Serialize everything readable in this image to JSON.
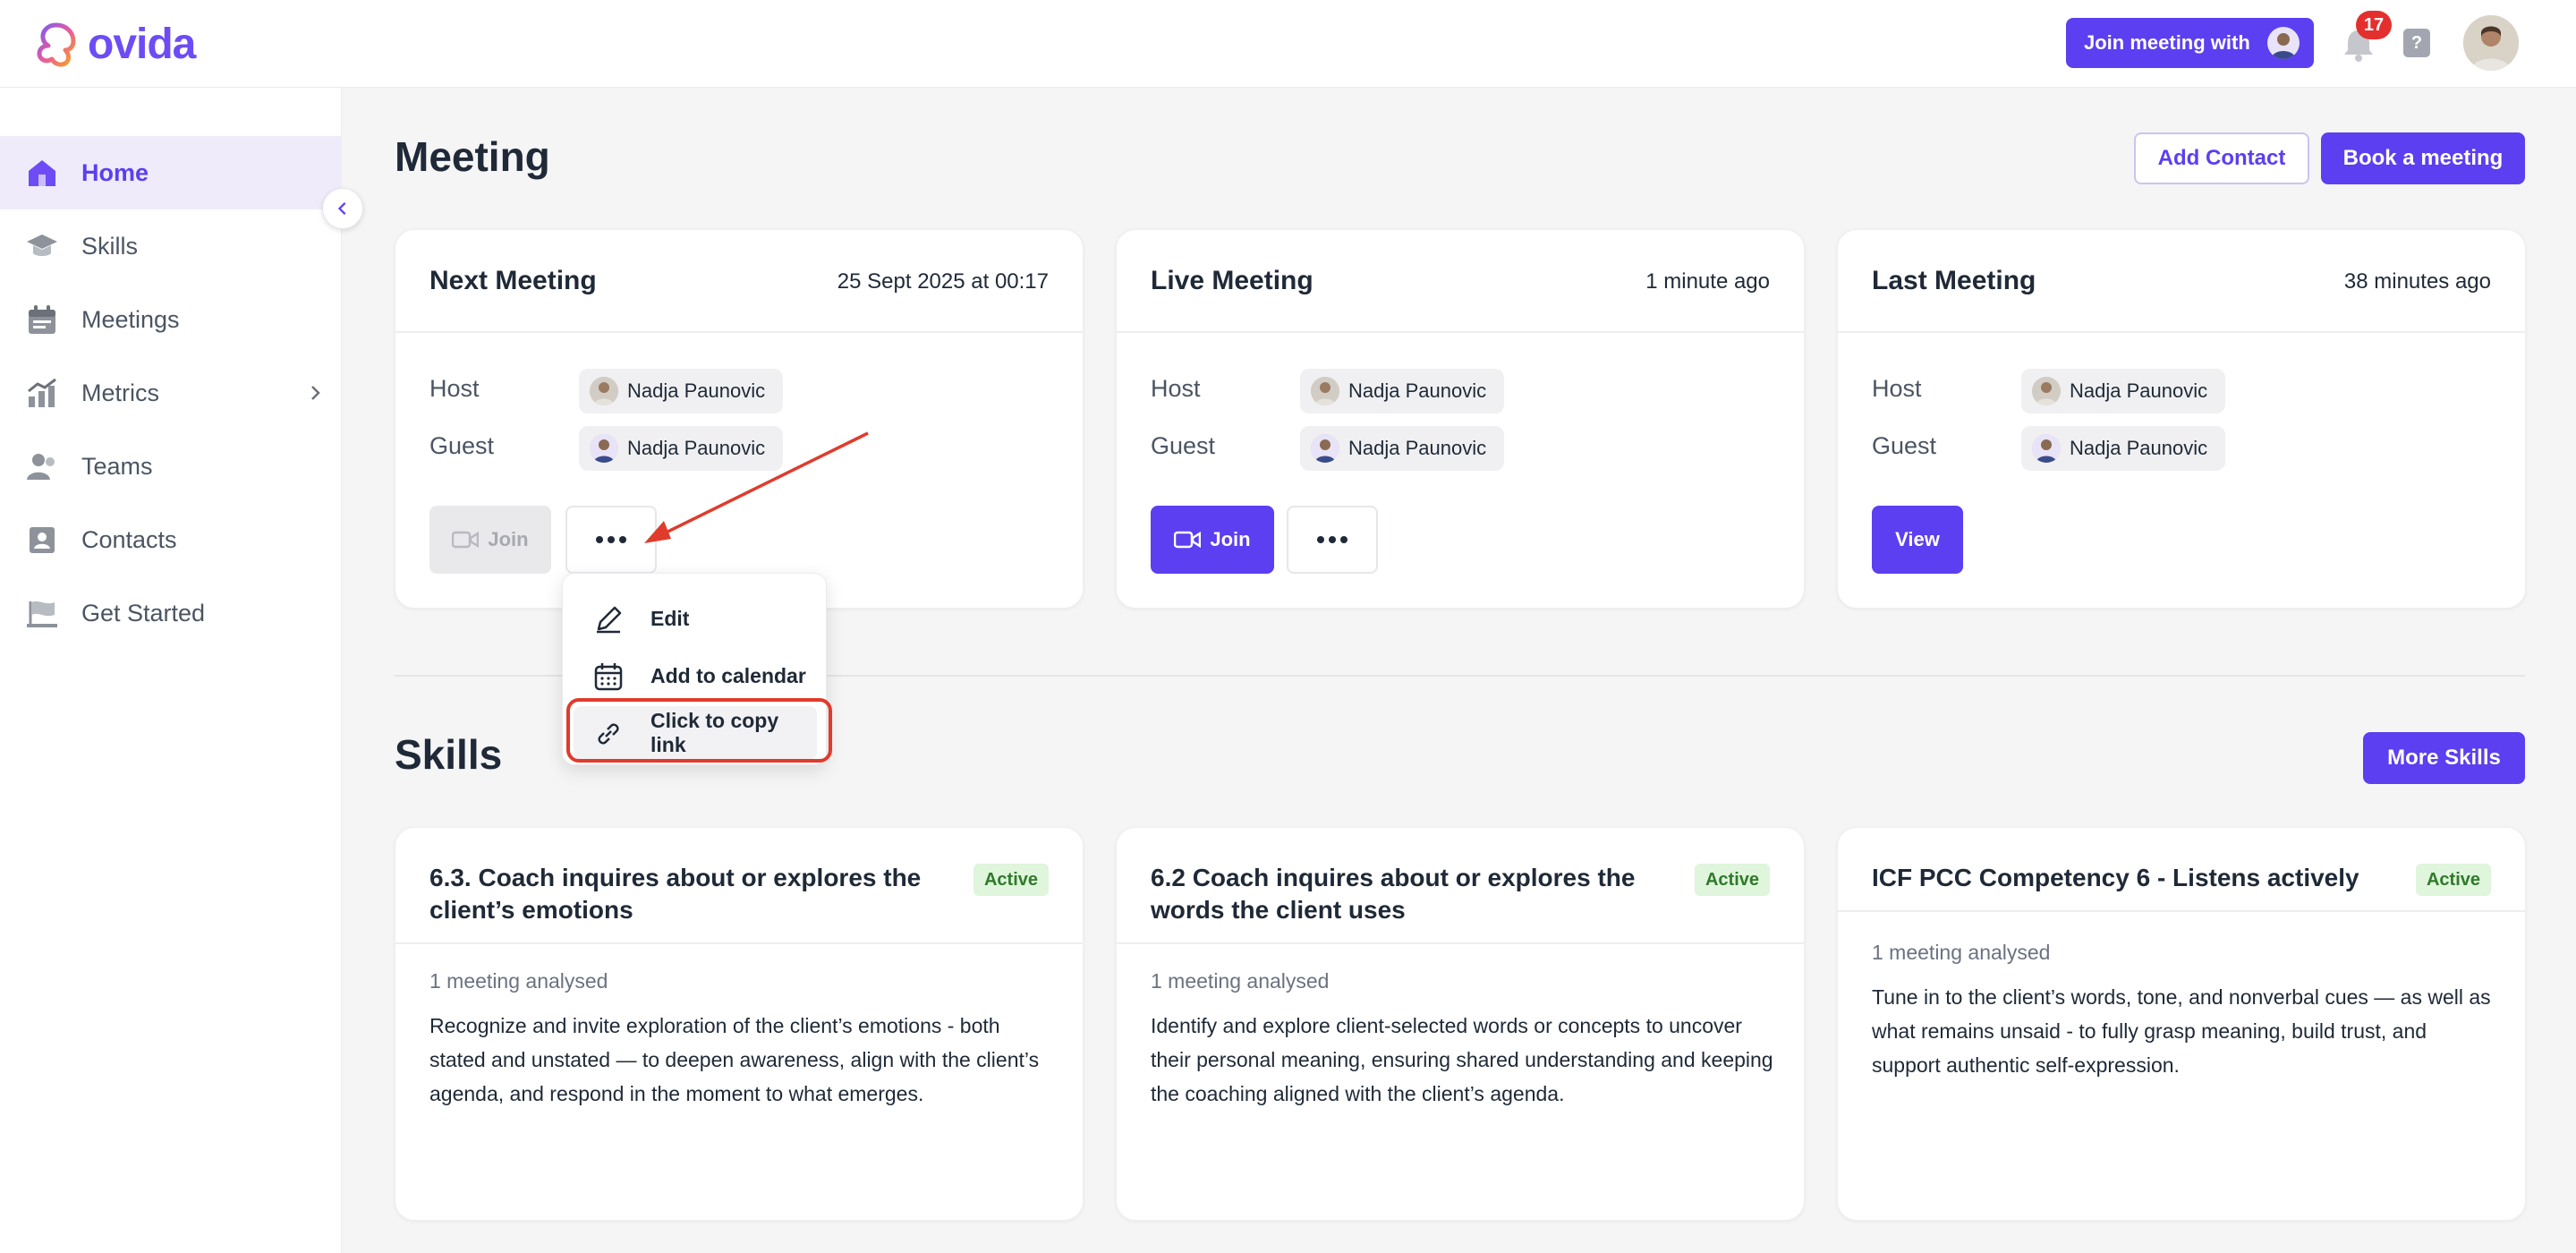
{
  "app": {
    "name": "ovida",
    "accent": "#5b3ff0"
  },
  "topbar": {
    "join_with_label": "Join meeting with",
    "notification_count": "17",
    "help_label": "?"
  },
  "sidebar": {
    "items": [
      {
        "label": "Home",
        "icon": "home-icon",
        "active": true
      },
      {
        "label": "Skills",
        "icon": "graduation-cap-icon"
      },
      {
        "label": "Meetings",
        "icon": "calendar-icon"
      },
      {
        "label": "Metrics",
        "icon": "chart-icon",
        "has_submenu": true
      },
      {
        "label": "Teams",
        "icon": "people-icon"
      },
      {
        "label": "Contacts",
        "icon": "contact-card-icon"
      },
      {
        "label": "Get Started",
        "icon": "flag-icon"
      }
    ]
  },
  "main": {
    "title": "Meeting",
    "add_contact_label": "Add Contact",
    "book_meeting_label": "Book a meeting",
    "meetings": [
      {
        "title": "Next Meeting",
        "time": "25 Sept 2025 at 00:17",
        "host_label": "Host",
        "host_name": "Nadja Paunovic",
        "guest_label": "Guest",
        "guest_name": "Nadja Paunovic",
        "join_label": "Join"
      },
      {
        "title": "Live Meeting",
        "time": "1 minute ago",
        "host_label": "Host",
        "host_name": "Nadja Paunovic",
        "guest_label": "Guest",
        "guest_name": "Nadja Paunovic",
        "join_label": "Join"
      },
      {
        "title": "Last Meeting",
        "time": "38 minutes ago",
        "host_label": "Host",
        "host_name": "Nadja Paunovic",
        "guest_label": "Guest",
        "guest_name": "Nadja Paunovic",
        "view_label": "View"
      }
    ],
    "menu": {
      "items": [
        {
          "label": "Edit",
          "icon": "pencil-icon"
        },
        {
          "label": "Add to calendar",
          "icon": "calendar-icon"
        },
        {
          "label": "Click to copy link",
          "icon": "link-icon"
        }
      ]
    },
    "skills_title": "Skills",
    "more_skills_label": "More Skills",
    "skills": [
      {
        "title": "6.3. Coach inquires about or explores the client’s emotions",
        "status": "Active",
        "meta": "1 meeting analysed",
        "description": "Recognize and invite exploration of the client’s emotions - both stated and unstated — to deepen awareness, align with the client’s agenda, and respond in the moment to what emerges."
      },
      {
        "title": "6.2 Coach inquires about or explores the words the client uses",
        "status": "Active",
        "meta": "1 meeting analysed",
        "description": "Identify and explore client-selected words or concepts to uncover their personal meaning, ensuring shared understanding and keeping the coaching aligned with the client’s agenda."
      },
      {
        "title": "ICF PCC Competency 6 - Listens actively",
        "status": "Active",
        "meta": "1 meeting analysed",
        "description": "Tune in to the client’s words, tone, and nonverbal cues — as well as what remains unsaid - to fully grasp meaning, build trust, and support authentic self-expression."
      }
    ]
  },
  "annotation": {
    "arrow_color": "#e03b2c"
  }
}
